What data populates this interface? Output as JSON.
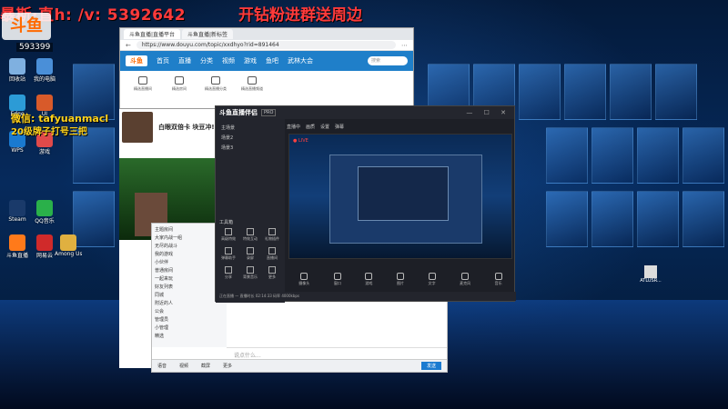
{
  "overlay": {
    "left_text": "暴斯·直h: /v:  5392642",
    "right_text": "开钻粉进群送周边",
    "logo_text": "斗鱼",
    "fan_badge": "593399"
  },
  "desktop_icons": [
    {
      "label": "回收站",
      "color": "#7fb0e0"
    },
    {
      "label": "我的电脑",
      "color": "#4a8fd8"
    },
    {
      "label": "Edge",
      "color": "#2c9bd6"
    },
    {
      "label": "UI",
      "color": "#d85a2a"
    },
    {
      "label": "WPS",
      "color": "#1a7ad0"
    },
    {
      "label": "游戏",
      "color": "#e04a4a"
    },
    {
      "label": "Steam",
      "color": "#1a3a6a"
    },
    {
      "label": "QQ音乐",
      "color": "#2ab04a"
    },
    {
      "label": "斗鱼直播",
      "color": "#ff7a1a"
    },
    {
      "label": "网易云",
      "color": "#d02a2a"
    },
    {
      "label": "Among Us",
      "color": "#e0b040"
    }
  ],
  "browser": {
    "tabs": [
      "斗鱼直播|直播平台",
      "斗鱼直播|新标签"
    ],
    "url": "https://www.douyu.com/topic/xxdhyo?rid=891464",
    "nav_items": [
      "首页",
      "直播",
      "分类",
      "视频",
      "游戏",
      "鱼吧",
      "武林大会"
    ],
    "search_placeholder": "搜索",
    "shortcuts": [
      "精选直播间",
      "精选房间",
      "精选直播分类",
      "精选直播频道"
    ],
    "logo": "斗鱼"
  },
  "stream_page": {
    "title": "白眼双倍卡 块豆冲!",
    "caption_line1": "微信: tafyuanmacl",
    "caption_line2": "20级牌子打号三把"
  },
  "chat_window": {
    "items": [
      "主题房间",
      "大家内战一组",
      "无尽的战斗",
      "我的游戏",
      "小伙伴",
      "普通房间",
      "一起来玩",
      "好友列表",
      "同城",
      "附近的人",
      "公会",
      "管理员",
      "小管理",
      "精选"
    ],
    "input_placeholder": "说点什么...",
    "bottom_items": [
      "语音",
      "视频",
      "截屏",
      "更多",
      "发送"
    ]
  },
  "obs": {
    "logo": "斗鱼直播伴侣",
    "tag": "PRO",
    "win_buttons": "— ☐ ✕",
    "scenes": [
      "主场景",
      "场景2",
      "场景3"
    ],
    "tools_header": "工具箱",
    "tools": [
      "高级特效",
      "特效互动",
      "礼物插件",
      "弹幕助手",
      "录屏",
      "直播间",
      "分享",
      "背景音乐",
      "更多"
    ],
    "topbar": [
      "直播中",
      "画质",
      "设置",
      "弹幕"
    ],
    "live_label": "● LIVE",
    "controls": [
      "摄像头",
      "窗口",
      "游戏",
      "图片",
      "文字",
      "麦克风",
      "音乐"
    ],
    "status": "正在直播 — 直播时长 02:14:33 码率 4000kbps"
  },
  "right_icon": {
    "label": "ATLUSR..."
  }
}
